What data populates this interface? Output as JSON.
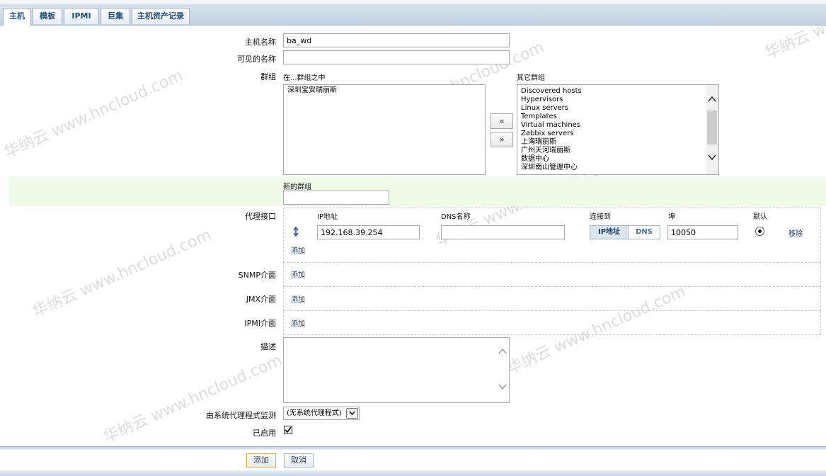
{
  "tabs": [
    {
      "label": "主机"
    },
    {
      "label": "模板"
    },
    {
      "label": "IPMI"
    },
    {
      "label": "巨集"
    },
    {
      "label": "主机资产记录"
    }
  ],
  "form": {
    "hostname_label": "主机名称",
    "hostname_value": "ba_wd",
    "visible_name_label": "可见的名称",
    "visible_name_value": "",
    "groups_label": "群组",
    "in_groups_label": "在...群组之中",
    "in_groups": [
      "深圳宝安瑞丽斯"
    ],
    "other_groups_label": "其它群组",
    "other_groups": [
      "Discovered hosts",
      "Hypervisors",
      "Linux servers",
      "Templates",
      "Virtual machines",
      "Zabbix servers",
      "上海瑞丽斯",
      "广州天河瑞丽斯",
      "数据中心",
      "深圳南山管理中心"
    ],
    "move_left": "«",
    "move_right": "»",
    "new_group_label": "新的群组",
    "new_group_value": "",
    "agent_label": "代理接口",
    "col_ip": "IP地址",
    "col_dns": "DNS名称",
    "col_connect": "连接到",
    "col_port": "埠",
    "col_default": "默认",
    "agent_ip": "192.168.39.254",
    "agent_dns": "",
    "connect_ip": "IP地址",
    "connect_dns": "DNS",
    "agent_port": "10050",
    "remove_link": "移除",
    "add_link": "添加",
    "snmp_label": "SNMP介面",
    "jmx_label": "JMX介面",
    "ipmi_label": "IPMI介面",
    "description_label": "描述",
    "description_value": "",
    "proxy_label": "由系统代理程式监测",
    "proxy_selected": "(无系统代理程式)",
    "enabled_label": "已启用",
    "enabled_checked": true
  },
  "footer": {
    "add_button": "添加",
    "cancel_button": "取消"
  },
  "watermark": [
    "华纳云 www.hncloud.com"
  ]
}
